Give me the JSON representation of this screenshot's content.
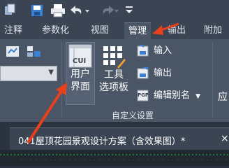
{
  "quick_access": {
    "icons": [
      "layers-icon",
      "save-icon",
      "print-icon",
      "undo-icon",
      "redo-icon",
      "dropdown-icon"
    ]
  },
  "ribbon_tabs": [
    {
      "label": "注释"
    },
    {
      "label": "参数化"
    },
    {
      "label": "视图"
    },
    {
      "label": "管理",
      "active": true
    },
    {
      "label": "输出"
    },
    {
      "label": "附加"
    }
  ],
  "customization_panel": {
    "user_interface_label_line1": "用户",
    "user_interface_label_line2": "界面",
    "tool_palettes_label_line1": "工具",
    "tool_palettes_label_line2": "选项板",
    "import_label": "输入",
    "export_label": "输出",
    "edit_aliases_label": "编辑别名",
    "panel_title": "自定义设置",
    "cui_badge": "CUI",
    "pgp_badge": "PGP",
    "next_panel_partial": "应"
  },
  "document_tab": {
    "title": "041屋顶花园景观设计方案（含效果图）*",
    "close_symbol": "×"
  },
  "colors": {
    "annotation_arrow": "#e8401c",
    "ribbon_bg": "#4a5566",
    "tab_bar_bg": "#3b4453"
  }
}
